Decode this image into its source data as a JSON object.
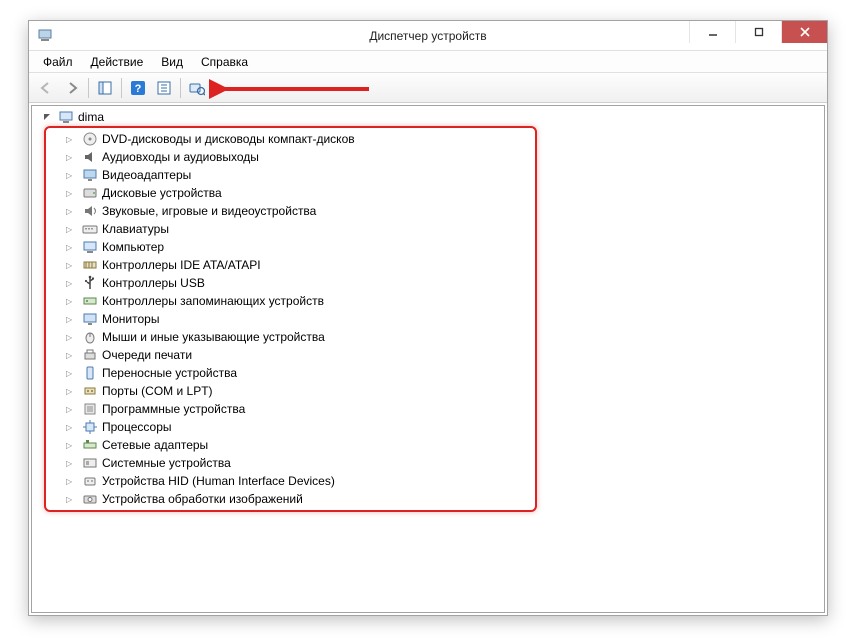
{
  "window": {
    "title": "Диспетчер устройств"
  },
  "menu": {
    "file": "Файл",
    "action": "Действие",
    "view": "Вид",
    "help": "Справка"
  },
  "tree": {
    "root": "dima",
    "items": [
      "DVD-дисководы и дисководы компакт-дисков",
      "Аудиовходы и аудиовыходы",
      "Видеоадаптеры",
      "Дисковые устройства",
      "Звуковые, игровые и видеоустройства",
      "Клавиатуры",
      "Компьютер",
      "Контроллеры IDE ATA/ATAPI",
      "Контроллеры USB",
      "Контроллеры запоминающих устройств",
      "Мониторы",
      "Мыши и иные указывающие устройства",
      "Очереди печати",
      "Переносные устройства",
      "Порты (COM и LPT)",
      "Программные устройства",
      "Процессоры",
      "Сетевые адаптеры",
      "Системные устройства",
      "Устройства HID (Human Interface Devices)",
      "Устройства обработки изображений"
    ]
  }
}
